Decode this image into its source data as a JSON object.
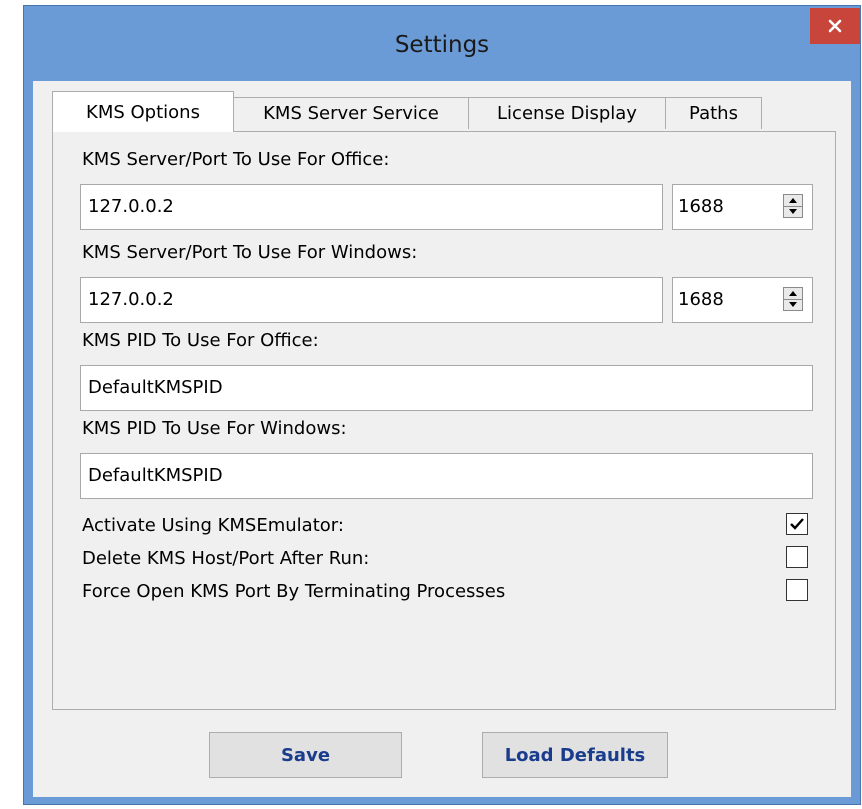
{
  "window": {
    "title": "Settings"
  },
  "tabs": [
    {
      "label": "KMS Options",
      "active": true
    },
    {
      "label": "KMS Server Service",
      "active": false
    },
    {
      "label": "License Display",
      "active": false
    },
    {
      "label": "Paths",
      "active": false
    }
  ],
  "kms_options": {
    "office_server_label": "KMS Server/Port To Use For Office:",
    "office_server_value": "127.0.0.2",
    "office_port_value": "1688",
    "windows_server_label": "KMS Server/Port To Use For Windows:",
    "windows_server_value": "127.0.0.2",
    "windows_port_value": "1688",
    "office_pid_label": "KMS PID To Use For Office:",
    "office_pid_value": "DefaultKMSPID",
    "windows_pid_label": "KMS PID To Use For Windows:",
    "windows_pid_value": "DefaultKMSPID",
    "activate_kmsemulator_label": "Activate Using KMSEmulator:",
    "activate_kmsemulator_checked": true,
    "delete_host_label": "Delete KMS Host/Port After Run:",
    "delete_host_checked": false,
    "force_open_label": "Force Open KMS Port By Terminating Processes",
    "force_open_checked": false
  },
  "buttons": {
    "save_label": "Save",
    "load_defaults_label": "Load Defaults"
  },
  "colors": {
    "window_frame": "#6b9bd6",
    "close_button": "#c7453b",
    "button_text": "#1a3c8c"
  }
}
